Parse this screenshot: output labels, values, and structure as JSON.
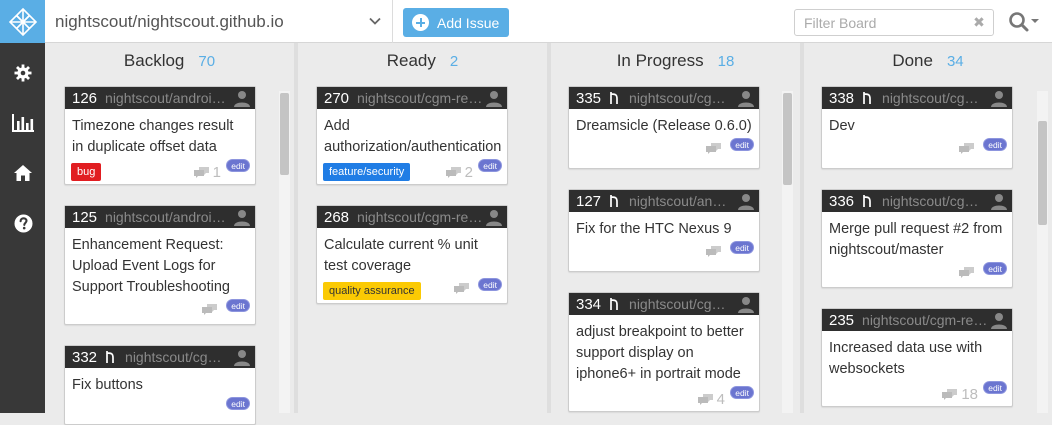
{
  "repo": {
    "name": "nightscout/nightscout.github.io"
  },
  "toolbar": {
    "add_issue_label": "Add Issue",
    "filter_placeholder": "Filter Board",
    "clear_symbol": "✖"
  },
  "nav": {
    "icons": [
      "gear-icon",
      "bar-chart-icon",
      "home-icon",
      "help-icon"
    ]
  },
  "columns": [
    {
      "title": "Backlog",
      "count": "70",
      "cards": [
        {
          "number": "126",
          "repo": "nightscout/android-uploader",
          "title": "Timezone changes result in duplicate offset data",
          "label": "bug",
          "label_color": "#e11d21",
          "comments": "1",
          "edit": "edit"
        },
        {
          "number": "125",
          "repo": "nightscout/android-uploader",
          "title": "Enhancement Request: Upload Event Logs for Support Troubleshooting",
          "comments": "",
          "edit": "edit"
        },
        {
          "number": "332",
          "repo": "nightscout/cgm-remote-monitor",
          "title": "Fix buttons",
          "pull_request": true,
          "comments": "",
          "edit": "edit"
        }
      ]
    },
    {
      "title": "Ready",
      "count": "2",
      "cards": [
        {
          "number": "270",
          "repo": "nightscout/cgm-remote-monitor",
          "title": "Add authorization/authentication",
          "label": "feature/security",
          "label_color": "#207de5",
          "comments": "2",
          "edit": "edit"
        },
        {
          "number": "268",
          "repo": "nightscout/cgm-remote-monitor",
          "title": "Calculate current % unit test coverage",
          "label": "quality assurance",
          "label_color": "#fbca04",
          "comments": "",
          "edit": "edit"
        }
      ]
    },
    {
      "title": "In Progress",
      "count": "18",
      "cards": [
        {
          "number": "335",
          "repo": "nightscout/cgm-remote-monitor",
          "title": "Dreamsicle (Release 0.6.0)",
          "pull_request": true,
          "comments": "",
          "edit": "edit"
        },
        {
          "number": "127",
          "repo": "nightscout/android-uploader",
          "title": "Fix for the HTC Nexus 9",
          "pull_request": true,
          "comments": "",
          "edit": "edit"
        },
        {
          "number": "334",
          "repo": "nightscout/cgm-remote-monitor",
          "title": "adjust breakpoint to better support display on iphone6+ in portrait mode",
          "pull_request": true,
          "comments": "4",
          "edit": "edit"
        }
      ]
    },
    {
      "title": "Done",
      "count": "34",
      "cards": [
        {
          "number": "338",
          "repo": "nightscout/cgm-remote-monitor",
          "title": "Dev",
          "pull_request": true,
          "comments": "",
          "edit": "edit"
        },
        {
          "number": "336",
          "repo": "nightscout/cgm-remote-monitor",
          "title": "Merge pull request #2 from nightscout/master",
          "pull_request": true,
          "comments": "",
          "edit": "edit"
        },
        {
          "number": "235",
          "repo": "nightscout/cgm-remote-monitor",
          "title": "Increased data use with websockets",
          "comments": "18",
          "edit": "edit"
        }
      ]
    }
  ]
}
